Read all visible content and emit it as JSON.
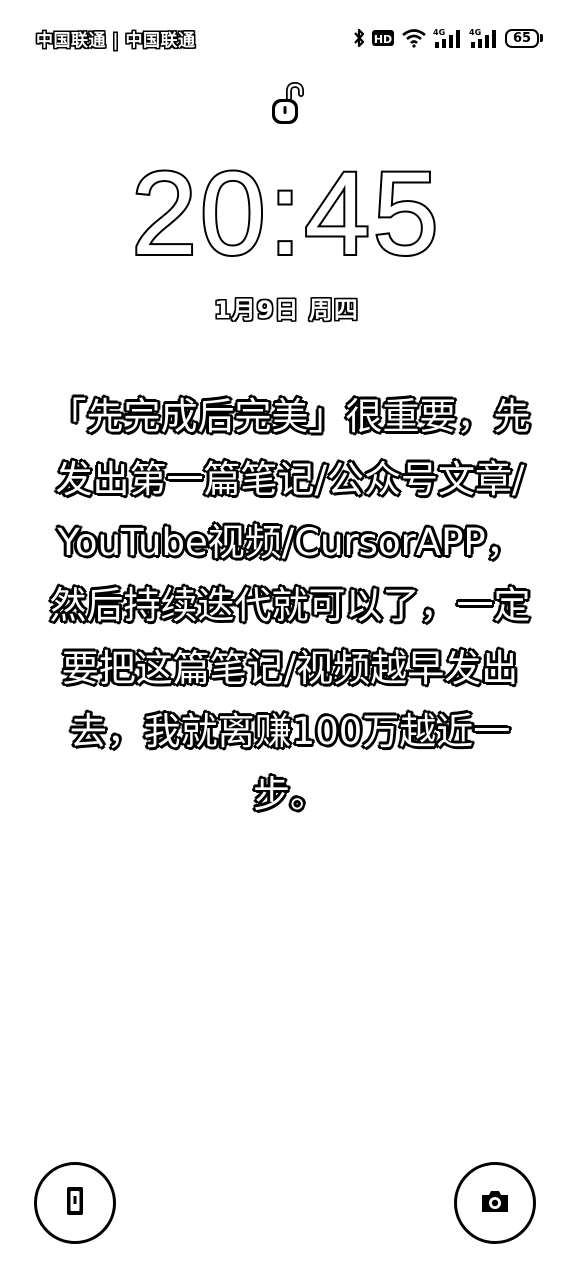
{
  "status_bar": {
    "carrier": "中国联通 | 中国联通",
    "battery_level": "65",
    "bluetooth_icon": "bluetooth-icon",
    "hd_badge": "HD",
    "wifi_icon": "wifi-icon",
    "signal_labels": [
      "4G",
      "4G"
    ]
  },
  "lock": {
    "icon": "unlock-icon"
  },
  "clock": {
    "time": "20:45"
  },
  "date": {
    "text": "1月9日 周四"
  },
  "message": {
    "text": "「先完成后完美」很重要，先发出第一篇笔记/公众号文章/YouTube视频/CursorAPP，然后持续迭代就可以了，一定要把这篇笔记/视频越早发出去，我就离赚100万越近一步。"
  },
  "shortcuts": {
    "left_icon": "flashlight-icon",
    "right_icon": "camera-icon"
  },
  "colors": {
    "background": "#ffffff",
    "text_fill": "#ffffff",
    "text_outline": "#000000"
  }
}
